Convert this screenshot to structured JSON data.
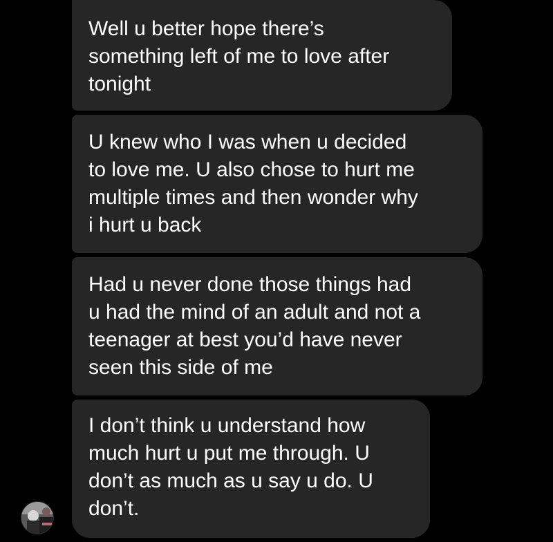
{
  "thread": {
    "messages": [
      {
        "text": "Well u better hope there’s\nsomething left of me to love after\ntonight"
      },
      {
        "text": "U knew who I was when u decided\nto love me. U also chose to hurt me\nmultiple times and then wonder why\ni hurt u back"
      },
      {
        "text": "Had u never done those things had\nu had the mind of an adult and not a\nteenager at best you’d have never\nseen this side of me"
      },
      {
        "text": "I don’t think u understand how\nmuch hurt u put me through. U\ndon’t as much as u say u do. U\ndon’t."
      }
    ],
    "colors": {
      "background": "#000000",
      "bubble": "#262626",
      "text": "#ffffff"
    },
    "sender_avatar": {
      "icon": "avatar-photo"
    }
  }
}
